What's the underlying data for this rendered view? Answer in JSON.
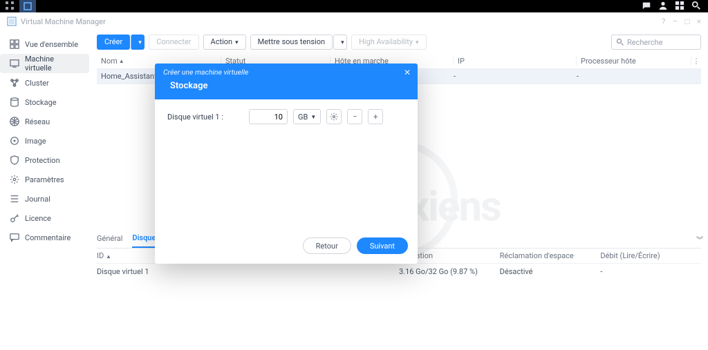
{
  "app": {
    "title": "Virtual Machine Manager"
  },
  "sidebar": {
    "items": [
      {
        "label": "Vue d'ensemble"
      },
      {
        "label": "Machine virtuelle"
      },
      {
        "label": "Cluster"
      },
      {
        "label": "Stockage"
      },
      {
        "label": "Réseau"
      },
      {
        "label": "Image"
      },
      {
        "label": "Protection"
      },
      {
        "label": "Paramètres"
      },
      {
        "label": "Journal"
      },
      {
        "label": "Licence"
      },
      {
        "label": "Commentaire"
      }
    ]
  },
  "toolbar": {
    "create": "Créer",
    "connect": "Connecter",
    "action": "Action",
    "power": "Mettre sous tension",
    "ha": "High Availability",
    "search_placeholder": "Recherche"
  },
  "table": {
    "cols": {
      "name": "Nom",
      "status": "Statut",
      "host": "Hôte en marche",
      "ip": "IP",
      "proc": "Processeur hôte"
    },
    "rows": [
      {
        "name": "Home_Assistant",
        "status": "",
        "host": "",
        "ip": "-",
        "proc": "-"
      }
    ]
  },
  "detail": {
    "tabs": {
      "general": "Général",
      "disk": "Disque vi"
    },
    "cols": {
      "id": "ID",
      "s1": "",
      "s2": "",
      "util": "Utilisation",
      "reclaim": "Réclamation d'espace",
      "debit": "Débit (Lire/Écrire)"
    },
    "rows": [
      {
        "id": "Disque virtuel 1",
        "util": "3.16 Go/32 Go (9.87 %)",
        "reclaim": "Désactivé",
        "debit": "-"
      }
    ]
  },
  "modal": {
    "title1": "Créer une machine virtuelle",
    "title2": "Stockage",
    "disk_label": "Disque virtuel 1 :",
    "disk_value": "10",
    "disk_unit": "GB",
    "back": "Retour",
    "next": "Suivant"
  },
  "watermark": "les alexiens"
}
